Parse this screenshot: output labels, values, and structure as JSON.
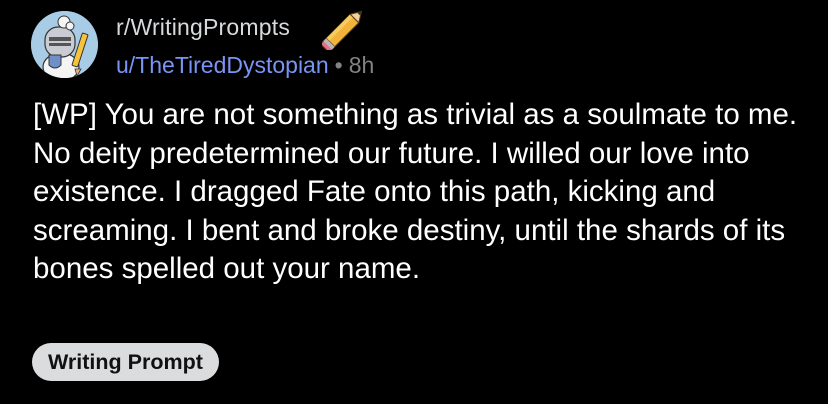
{
  "subreddit": "r/WritingPrompts",
  "author": "u/TheTiredDystopian",
  "separator": "•",
  "time_ago": "8h",
  "title": "[WP] You are not something as trivial as a soulmate to me. No deity predetermined our future. I willed our love into existence. I dragged Fate onto this path, kicking and screaming. I bent and broke destiny, until the shards of its bones spelled out your name.",
  "flair": "Writing Prompt",
  "colors": {
    "background": "#000000",
    "username": "#7a94f5",
    "muted": "#818384",
    "flair_bg": "#dadcde"
  },
  "icons": [
    "subreddit-avatar-icon",
    "pencil-icon"
  ]
}
